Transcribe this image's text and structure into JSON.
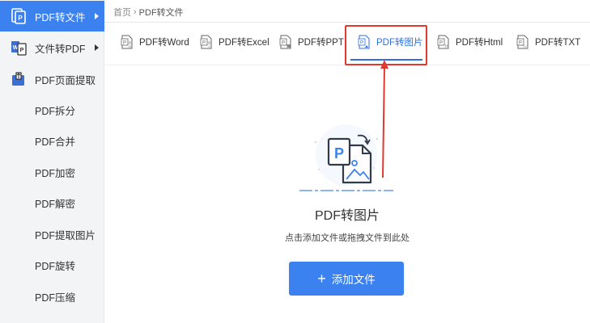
{
  "sidebar": {
    "items": [
      {
        "label": "PDF转文件",
        "icon": "pdf-to-file-icon",
        "has_arrow": true,
        "active": true
      },
      {
        "label": "文件转PDF",
        "icon": "file-to-pdf-icon",
        "has_arrow": true,
        "active": false
      },
      {
        "label": "PDF页面提取",
        "icon": "page-extract-icon",
        "has_arrow": false,
        "active": false
      },
      {
        "label": "PDF拆分"
      },
      {
        "label": "PDF合并"
      },
      {
        "label": "PDF加密"
      },
      {
        "label": "PDF解密"
      },
      {
        "label": "PDF提取图片"
      },
      {
        "label": "PDF旋转"
      },
      {
        "label": "PDF压缩"
      }
    ]
  },
  "breadcrumb": {
    "home": "首页",
    "separator": "›",
    "current": "PDF转文件"
  },
  "tabs": [
    {
      "label": "PDF转Word",
      "icon": "word-doc-icon"
    },
    {
      "label": "PDF转Excel",
      "icon": "excel-doc-icon"
    },
    {
      "label": "PDF转PPT",
      "icon": "ppt-doc-icon"
    },
    {
      "label": "PDF转图片",
      "icon": "image-doc-icon",
      "active": true
    },
    {
      "label": "PDF转Html",
      "icon": "html-doc-icon"
    },
    {
      "label": "PDF转TXT",
      "icon": "txt-doc-icon"
    }
  ],
  "main": {
    "title": "PDF转图片",
    "hint": "点击添加文件或拖拽文件到此处",
    "add_button": "添加文件"
  },
  "colors": {
    "accent": "#3b82f0",
    "highlight": "#e03a30",
    "sidebar_bg": "#f3f4f6"
  }
}
